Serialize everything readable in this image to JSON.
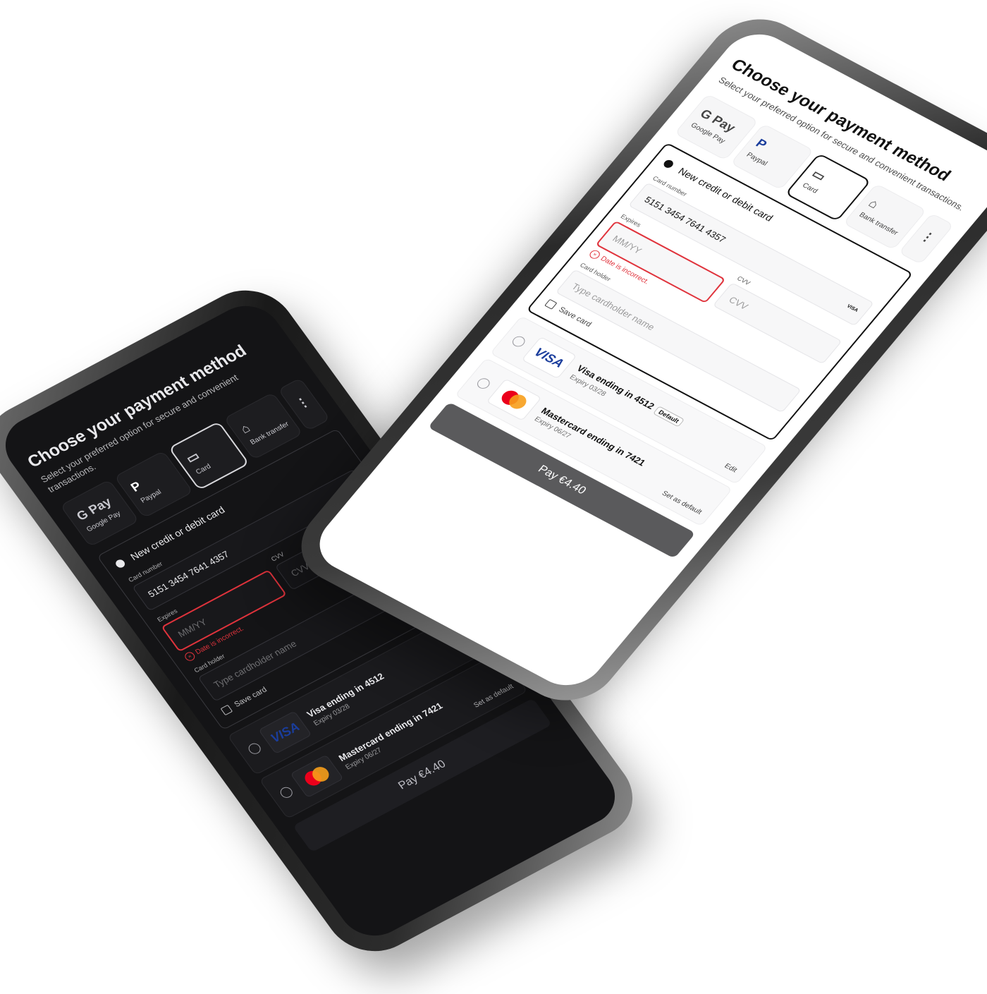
{
  "screen": {
    "title": "Choose your payment method",
    "subtitle": "Select your preferred option for secure and convenient transactions.",
    "methods": [
      {
        "icon": "G Pay",
        "label": "Google Pay"
      },
      {
        "icon": "P",
        "label": "Paypal"
      },
      {
        "icon": "▭",
        "label": "Card"
      },
      {
        "icon": "⌂",
        "label": "Bank transfer"
      },
      {
        "icon": "⋮",
        "label": ""
      }
    ],
    "selected_method": "Card",
    "new_card": {
      "option_label": "New credit or debit card",
      "card_number_label": "Card number",
      "card_number_value": "5151 3454 7641 4357",
      "card_brand": "VISA",
      "expires_label": "Expires",
      "expires_placeholder": "MM/YY",
      "expires_error": "Date is incorrect.",
      "cvv_label": "CVV",
      "cvv_placeholder": "CVV",
      "holder_label": "Card holder",
      "holder_placeholder": "Type cardholder name",
      "save_card_label": "Save card"
    },
    "saved_cards": [
      {
        "brand": "VISA",
        "name": "Visa ending in 4512",
        "badge": "Default",
        "expiry": "Expiry 03/28",
        "action": "Edit"
      },
      {
        "brand": "Mastercard",
        "name": "Mastercard ending in 7421",
        "badge": "",
        "expiry": "Expiry 06/27",
        "action": "Set as default"
      }
    ],
    "pay_button": "Pay €4.40"
  },
  "colors": {
    "error": "#e0333c",
    "visa_blue": "#1a3d9c",
    "mc_red": "#eb001b",
    "mc_orange": "#f79e1b"
  }
}
